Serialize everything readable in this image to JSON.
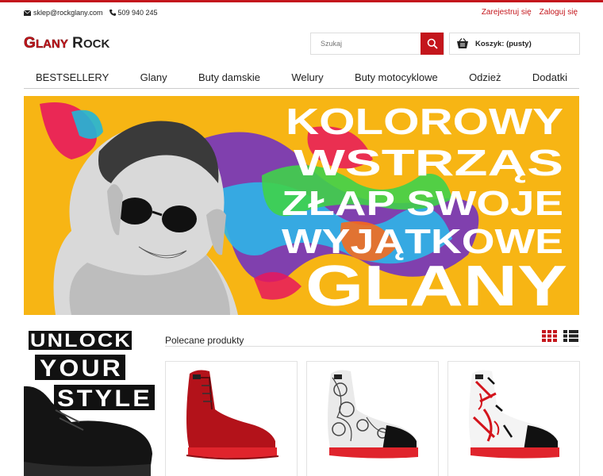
{
  "header": {
    "email": "sklep@rockglany.com",
    "phone": "509 940 245",
    "register_label": "Zarejestruj się",
    "login_label": "Zaloguj się"
  },
  "logo": {
    "text_first": "Glany",
    "text_second": "Rock"
  },
  "search": {
    "placeholder": "Szukaj",
    "icon": "search-icon"
  },
  "cart": {
    "label": "Koszyk: (pusty)",
    "icon": "basket-icon"
  },
  "nav": {
    "items": [
      {
        "label": "BESTSELLERY"
      },
      {
        "label": "Glany"
      },
      {
        "label": "Buty damskie"
      },
      {
        "label": "Welury"
      },
      {
        "label": "Buty motocyklowe"
      },
      {
        "label": "Odzież"
      },
      {
        "label": "Dodatki"
      }
    ]
  },
  "banner": {
    "lines": [
      "KOLOROWY",
      "WSTRZĄS",
      "ZŁAP SWOJE",
      "WYJĄTKOWE",
      "GLANY"
    ]
  },
  "sidebox": {
    "lines": [
      "UNLOCK",
      "YOUR",
      "STYLE"
    ]
  },
  "featured": {
    "title": "Polecane produkty",
    "grid_icon": "grid-view-icon",
    "list_icon": "list-view-icon"
  },
  "colors": {
    "accent": "#c4161c",
    "banner_bg": "#f7b514"
  }
}
